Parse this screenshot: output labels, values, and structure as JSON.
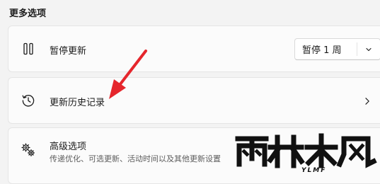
{
  "section": {
    "title": "更多选项"
  },
  "pause_updates": {
    "icon": "pause-icon",
    "label": "暂停更新",
    "dropdown_value": "暂停 1 周"
  },
  "update_history": {
    "icon": "history-icon",
    "label": "更新历史记录"
  },
  "advanced_options": {
    "icon": "gears-icon",
    "label": "高级选项",
    "description": "传递优化、可选更新、活动时间以及其他更新设置"
  },
  "watermark": {
    "brand": "雨林木风",
    "sub": "YLMF"
  },
  "colors": {
    "background": "#f3f3f3",
    "card": "#fbfbfb",
    "annotation_arrow": "#e5262c"
  }
}
